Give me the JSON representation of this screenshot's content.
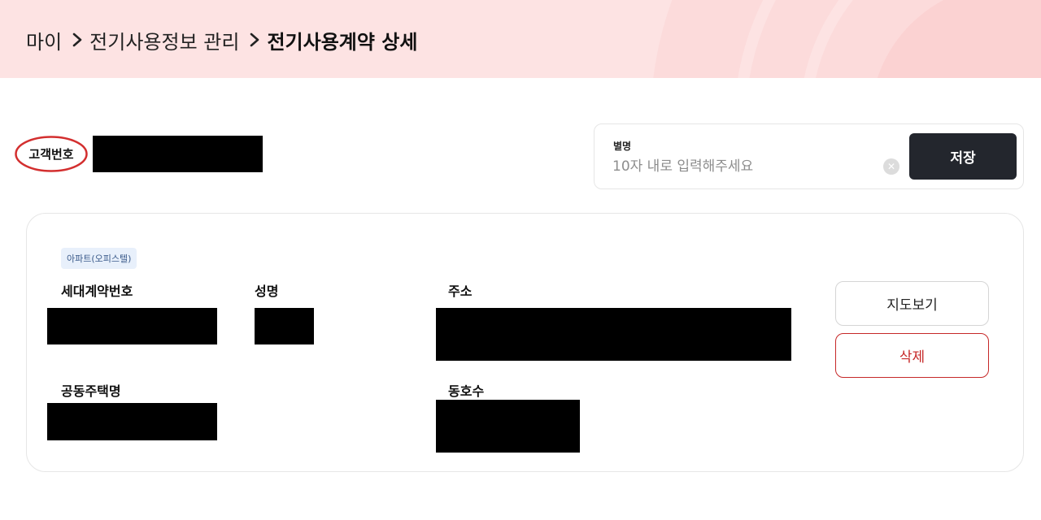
{
  "breadcrumb": {
    "items": [
      "마이",
      "전기사용정보 관리"
    ],
    "current": "전기사용계약 상세"
  },
  "customer": {
    "label": "고객번호",
    "highlight_color": "#d32f2f"
  },
  "alias": {
    "label": "별명",
    "placeholder": "10자 내로 입력해주세요",
    "value": "",
    "save_label": "저장",
    "clear_icon": "close-circle-icon"
  },
  "contract": {
    "badge": "아파트(오피스텔)",
    "fields": {
      "household_contract_no": "세대계약번호",
      "name": "성명",
      "address": "주소",
      "complex_name": "공동주택명",
      "unit_no": "동호수"
    },
    "actions": {
      "map": "지도보기",
      "delete": "삭제"
    }
  },
  "colors": {
    "header_bg": "#fde3e3",
    "primary_button": "#23262d",
    "danger": "#c62828",
    "badge_bg": "#e8f0fb"
  }
}
